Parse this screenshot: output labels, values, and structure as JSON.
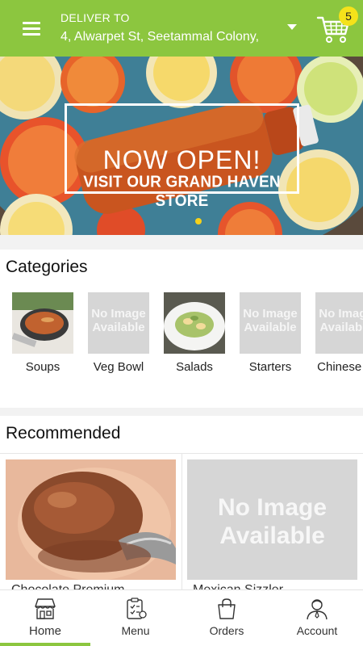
{
  "header": {
    "deliver_label": "DELIVER TO",
    "address": "4, Alwarpet St, Seetammal Colony,",
    "cart_count": "5",
    "background": "#8cc63f"
  },
  "banner": {
    "title": "NOW OPEN!",
    "subtitle": "VISIT OUR GRAND HAVEN STORE",
    "slides": 1
  },
  "categories": {
    "title": "Categories",
    "items": [
      {
        "name": "Soups",
        "image": "soup-photo"
      },
      {
        "name": "Veg Bowl",
        "image": "no-image",
        "placeholder": "No Image Available"
      },
      {
        "name": "Salads",
        "image": "salad-photo"
      },
      {
        "name": "Starters",
        "image": "no-image",
        "placeholder": "No Image Available"
      },
      {
        "name": "Chinese M",
        "image": "no-image",
        "placeholder": "No Image Available"
      }
    ]
  },
  "recommended": {
    "title": "Recommended",
    "items": [
      {
        "name": "Chocolate Premium",
        "image": "ice-cream-photo"
      },
      {
        "name": "Mexican Sizzler",
        "image": "no-image",
        "placeholder": "No Image Available"
      }
    ]
  },
  "bottom_nav": {
    "items": [
      {
        "label": "Home",
        "icon": "store-icon",
        "active": true
      },
      {
        "label": "Menu",
        "icon": "menu-list-icon",
        "active": false
      },
      {
        "label": "Orders",
        "icon": "shopping-bag-icon",
        "active": false
      },
      {
        "label": "Account",
        "icon": "user-icon",
        "active": false
      }
    ],
    "accent": "#8cc63f"
  }
}
